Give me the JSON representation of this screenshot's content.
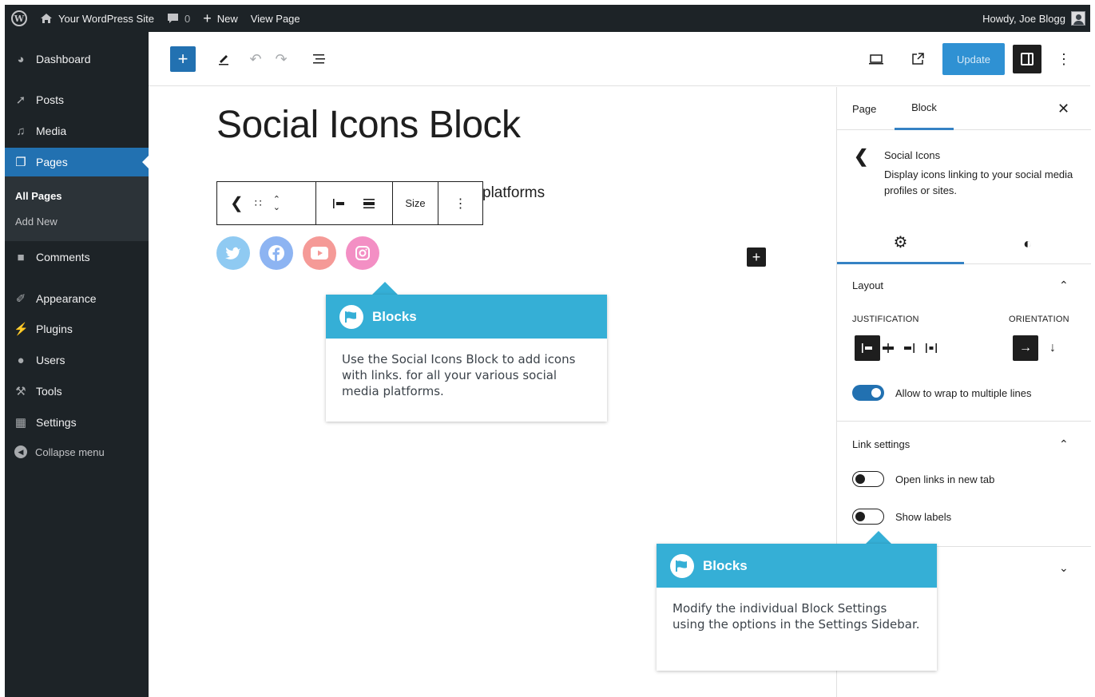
{
  "admin_bar": {
    "site_name": "Your WordPress Site",
    "comments_count": "0",
    "new_label": "New",
    "view_page_label": "View Page",
    "greeting": "Howdy, Joe Blogg"
  },
  "admin_menu": {
    "items": [
      {
        "label": "Dashboard",
        "icon": "dashboard-icon"
      },
      {
        "label": "Posts",
        "icon": "pin-icon"
      },
      {
        "label": "Media",
        "icon": "media-icon"
      },
      {
        "label": "Pages",
        "icon": "pages-icon"
      },
      {
        "label": "Comments",
        "icon": "comment-icon"
      },
      {
        "label": "Appearance",
        "icon": "brush-icon"
      },
      {
        "label": "Plugins",
        "icon": "plug-icon"
      },
      {
        "label": "Users",
        "icon": "users-icon"
      },
      {
        "label": "Tools",
        "icon": "wrench-icon"
      },
      {
        "label": "Settings",
        "icon": "settings-icon"
      }
    ],
    "submenu": [
      {
        "label": "All Pages"
      },
      {
        "label": "Add New"
      }
    ],
    "collapse_label": "Collapse menu"
  },
  "toolbar": {
    "update_label": "Update"
  },
  "editor": {
    "title": "Social Icons Block",
    "paragraph_fragment": "platforms",
    "block_toolbar": {
      "size_label": "Size"
    },
    "social_icons": [
      {
        "name": "twitter",
        "color": "#8fcaf2"
      },
      {
        "name": "facebook",
        "color": "#8db4f2"
      },
      {
        "name": "youtube",
        "color": "#f59a97"
      },
      {
        "name": "instagram",
        "color": "#f38fc4"
      }
    ]
  },
  "sidebar": {
    "tabs": [
      "Page",
      "Block"
    ],
    "active_tab": "Block",
    "block_name": "Social Icons",
    "block_description": "Display icons linking to your social media profiles or sites.",
    "layout": {
      "title": "Layout",
      "justification_label": "JUSTIFICATION",
      "orientation_label": "ORIENTATION",
      "wrap_label": "Allow to wrap to multiple lines",
      "wrap_enabled": true
    },
    "link_settings": {
      "title": "Link settings",
      "new_tab_label": "Open links in new tab",
      "new_tab_enabled": false,
      "show_labels_label": "Show labels",
      "show_labels_enabled": false
    }
  },
  "callouts": [
    {
      "title": "Blocks",
      "body": "Use the Social Icons Block to add icons with links. for all your various social media platforms."
    },
    {
      "title": "Blocks",
      "body": "Modify the individual Block Settings using the options in the Settings Sidebar."
    }
  ],
  "colors": {
    "admin_dark": "#1d2327",
    "accent_blue": "#2271b1",
    "callout_blue": "#35afd6"
  }
}
